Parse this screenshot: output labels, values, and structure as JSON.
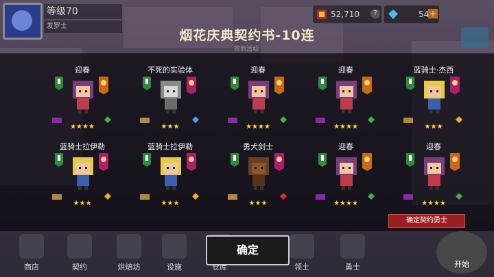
{
  "hud": {
    "level": "等级70",
    "title": "发罗士",
    "gold": "52,710",
    "gems": "54",
    "gold_icon": "coin-icon",
    "gem_icon": "diamond-icon"
  },
  "banner": {
    "title": "烟花庆典契约书-10连",
    "subtitle": "签到活动"
  },
  "results": [
    {
      "name": "迎春",
      "stars": "★★★★",
      "palette": "pink-hair"
    },
    {
      "name": "不死的实验体",
      "stars": "★★★",
      "palette": "grey-hair"
    },
    {
      "name": "迎春",
      "stars": "★★★★",
      "palette": "pink-hair"
    },
    {
      "name": "迎春",
      "stars": "★★★★",
      "palette": "pink-hair"
    },
    {
      "name": "蓝骑士·杰西",
      "stars": "★★★",
      "palette": "blonde"
    },
    {
      "name": "蓝骑士拉伊勒",
      "stars": "★★★",
      "palette": "blonde"
    },
    {
      "name": "蓝骑士拉伊勒",
      "stars": "★★★",
      "palette": "blonde"
    },
    {
      "name": "勇犬剑士",
      "stars": "★★★",
      "palette": "dog"
    },
    {
      "name": "迎春",
      "stars": "★★★★",
      "palette": "pink-hair"
    },
    {
      "name": "迎春",
      "stars": "★★★★",
      "palette": "pink-hair"
    }
  ],
  "nav": [
    {
      "label": "商店",
      "icon": "shop-icon"
    },
    {
      "label": "契约",
      "icon": "contract-icon"
    },
    {
      "label": "烘焙坊",
      "icon": "bakery-icon"
    },
    {
      "label": "设施",
      "icon": "facility-icon"
    },
    {
      "label": "仓库",
      "icon": "warehouse-icon"
    },
    {
      "label": "领土",
      "icon": "territory-icon"
    },
    {
      "label": "勇士",
      "icon": "hero-icon"
    }
  ],
  "buttons": {
    "confirm": "确定",
    "confirm_contract_knight": "确定契约勇士",
    "start": "开始"
  },
  "colors": {
    "star": "#ffd23a",
    "badge_green": "#2f8a3c",
    "badge_magenta": "#a8206a",
    "badge_orange": "#c96a1a",
    "knight_label": "#9a2020"
  }
}
